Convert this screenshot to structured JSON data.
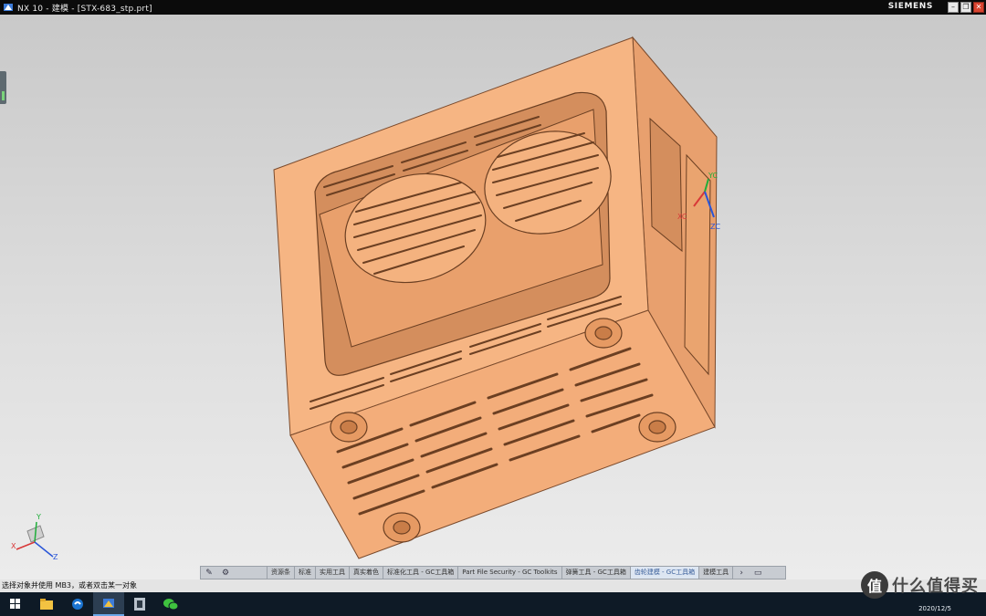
{
  "window": {
    "title": "NX 10 - 建模 - [STX-683_stp.prt]",
    "brand": "SIEMENS",
    "buttons": [
      "minimize",
      "restore",
      "close"
    ]
  },
  "viewport": {
    "model_color": "#f5b07c",
    "model_edge_color": "#7a4a2c",
    "csys": {
      "x_label": "XC",
      "y_label": "YC",
      "z_label": "ZC"
    },
    "triad": {
      "x": "X",
      "y": "Y",
      "z": "Z"
    }
  },
  "toolbar": {
    "items": [
      "资源条",
      "标准",
      "实用工具",
      "真实着色",
      "标准化工具 - GC工具箱",
      "Part File Security - GC Toolkits",
      "弹簧工具 - GC工具箱",
      "齿轮建模 - GC工具箱",
      "建模工具"
    ],
    "active_index": 7
  },
  "status": {
    "text": "选择对象并使用 MB3，或者双击某一对象"
  },
  "taskbar": {
    "date": "2020/12/5",
    "apps": [
      "windows-icon",
      "file-explorer-icon",
      "edge-icon",
      "nx-icon",
      "app-icon",
      "wechat-icon"
    ]
  },
  "watermark": {
    "glyph": "值",
    "text": "什么值得买"
  }
}
